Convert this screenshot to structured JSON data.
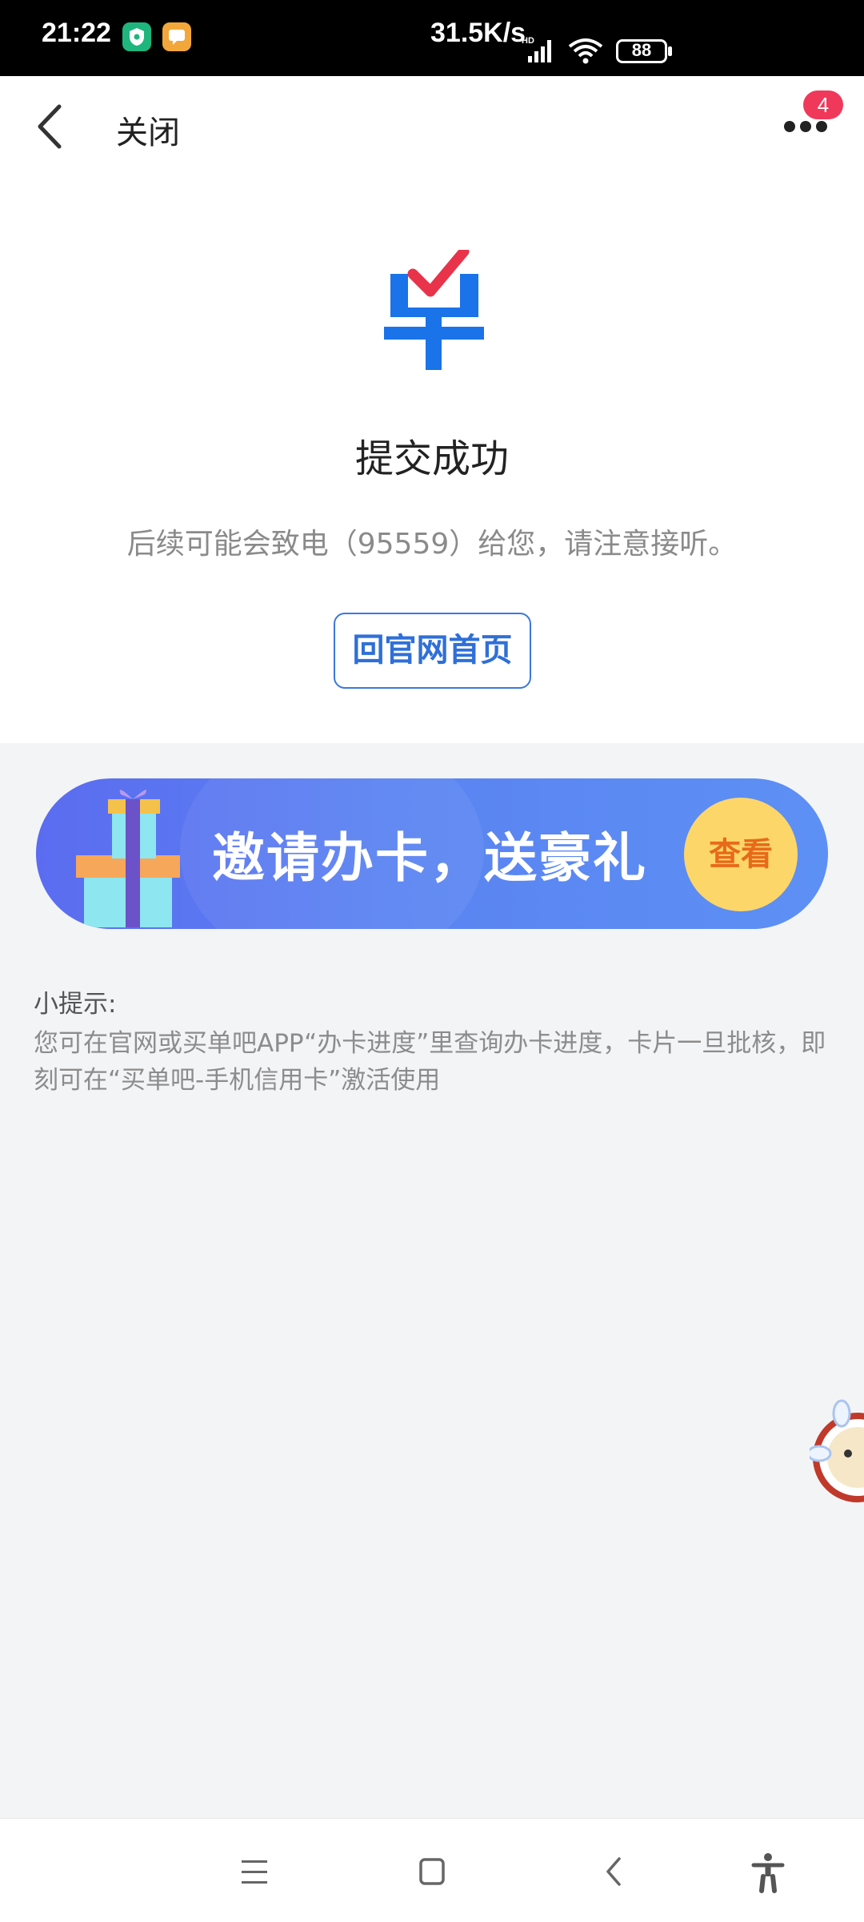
{
  "status_bar": {
    "time": "21:22",
    "network_speed": "31.5K/s",
    "battery": "88",
    "icons": [
      "shield-app-icon",
      "message-app-icon",
      "signal-icon",
      "wifi-icon",
      "battery-icon"
    ]
  },
  "header": {
    "close_label": "关闭",
    "badge_count": "4",
    "icons": [
      "back-arrow-icon",
      "more-dots-icon"
    ]
  },
  "success": {
    "title": "提交成功",
    "description": "后续可能会致电（95559）给您，请注意接听。",
    "home_button": "回官网首页"
  },
  "banner": {
    "text": "邀请办卡，送豪礼",
    "button": "查看"
  },
  "tips": {
    "title": "小提示:",
    "body": "您可在官网或买单吧APP“办卡进度”里查询办卡进度，卡片一旦批核，即刻可在“买单吧-手机信用卡”激活使用"
  },
  "colors": {
    "primary_blue": "#2f6fd8",
    "logo_blue": "#1a73e8",
    "logo_check_red": "#e8334a",
    "badge_red": "#f0395a",
    "banner_gold": "#fdd66a",
    "banner_orange_text": "#e76a1a"
  },
  "nav_bar": {
    "icons": [
      "menu-icon",
      "home-square-icon",
      "back-chevron-icon",
      "accessibility-icon"
    ]
  }
}
